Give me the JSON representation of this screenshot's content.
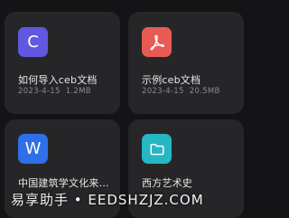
{
  "files": [
    {
      "name": "如何导入ceb文档",
      "date": "2023-4-15",
      "size": "1.2MB",
      "icon": "letter-c-icon",
      "icon_letter": "C",
      "icon_color": "#6257e0"
    },
    {
      "name": "示例ceb文档",
      "date": "2023-4-15",
      "size": "20.5MB",
      "icon": "pdf-icon",
      "icon_color": "#e85a54"
    },
    {
      "name": "中国建筑学文化来…",
      "icon": "word-w-icon",
      "icon_letter": "W",
      "icon_color": "#2f6fe8"
    },
    {
      "name": "西方艺术史",
      "icon": "folder-icon",
      "icon_color": "#26b7c4"
    }
  ],
  "watermark": {
    "text": "易享助手 • EEDSHZJZ.COM"
  }
}
